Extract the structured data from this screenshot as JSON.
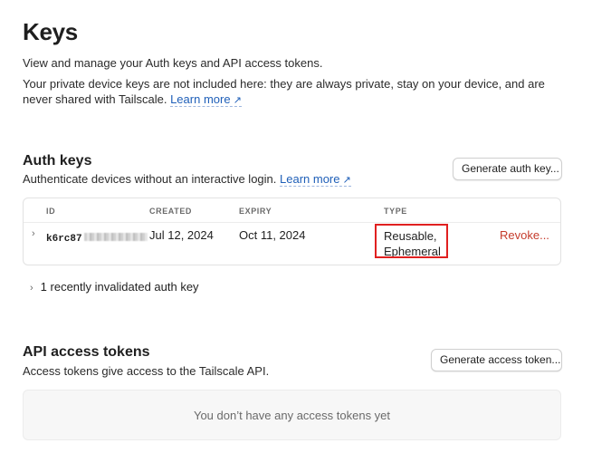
{
  "page": {
    "title": "Keys",
    "subtitle": "View and manage your Auth keys and API access tokens.",
    "private_note": "Your private device keys are not included here: they are always private, stay on your device, and are never shared with Tailscale.",
    "learn_more": "Learn more"
  },
  "auth_keys": {
    "title": "Auth keys",
    "description": "Authenticate devices without an interactive login.",
    "learn_more": "Learn more",
    "generate_button": "Generate auth key...",
    "columns": {
      "id": "ID",
      "created": "CREATED",
      "expiry": "EXPIRY",
      "type": "TYPE"
    },
    "rows": [
      {
        "id": "k6rc87",
        "created": "Jul 12, 2024",
        "expiry": "Oct 11, 2024",
        "type_line1": "Reusable,",
        "type_line2": "Ephemeral",
        "revoke": "Revoke..."
      }
    ],
    "invalidated": "1 recently invalidated auth key"
  },
  "api_tokens": {
    "title": "API access tokens",
    "description": "Access tokens give access to the Tailscale API.",
    "generate_button": "Generate access token...",
    "empty_text": "You don’t have any access tokens yet"
  },
  "icons": {
    "external": "↗",
    "chevron": "›"
  },
  "colors": {
    "link": "#1f5fb8",
    "danger": "#c53b2b",
    "highlight": "#e02020"
  }
}
